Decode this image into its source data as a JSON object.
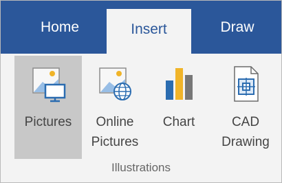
{
  "tabs": {
    "home": "Home",
    "insert": "Insert",
    "draw": "Draw"
  },
  "buttons": {
    "pictures": {
      "label": "Pictures",
      "icon": "pictures-icon"
    },
    "online_pictures": {
      "line1": "Online",
      "line2": "Pictures",
      "icon": "online-pictures-icon"
    },
    "chart": {
      "label": "Chart",
      "icon": "chart-icon"
    },
    "cad_drawing": {
      "line1": "CAD",
      "line2": "Drawing",
      "icon": "cad-drawing-icon"
    }
  },
  "group_label": "Illustrations",
  "colors": {
    "ribbon_blue": "#2b579a",
    "ribbon_body": "#f3f3f3",
    "selected_button": "#c8c8c8",
    "accent_sky": "#4a90d9",
    "accent_sun": "#f0b429"
  },
  "state": {
    "active_tab": "Insert",
    "highlighted_button": "Pictures"
  }
}
